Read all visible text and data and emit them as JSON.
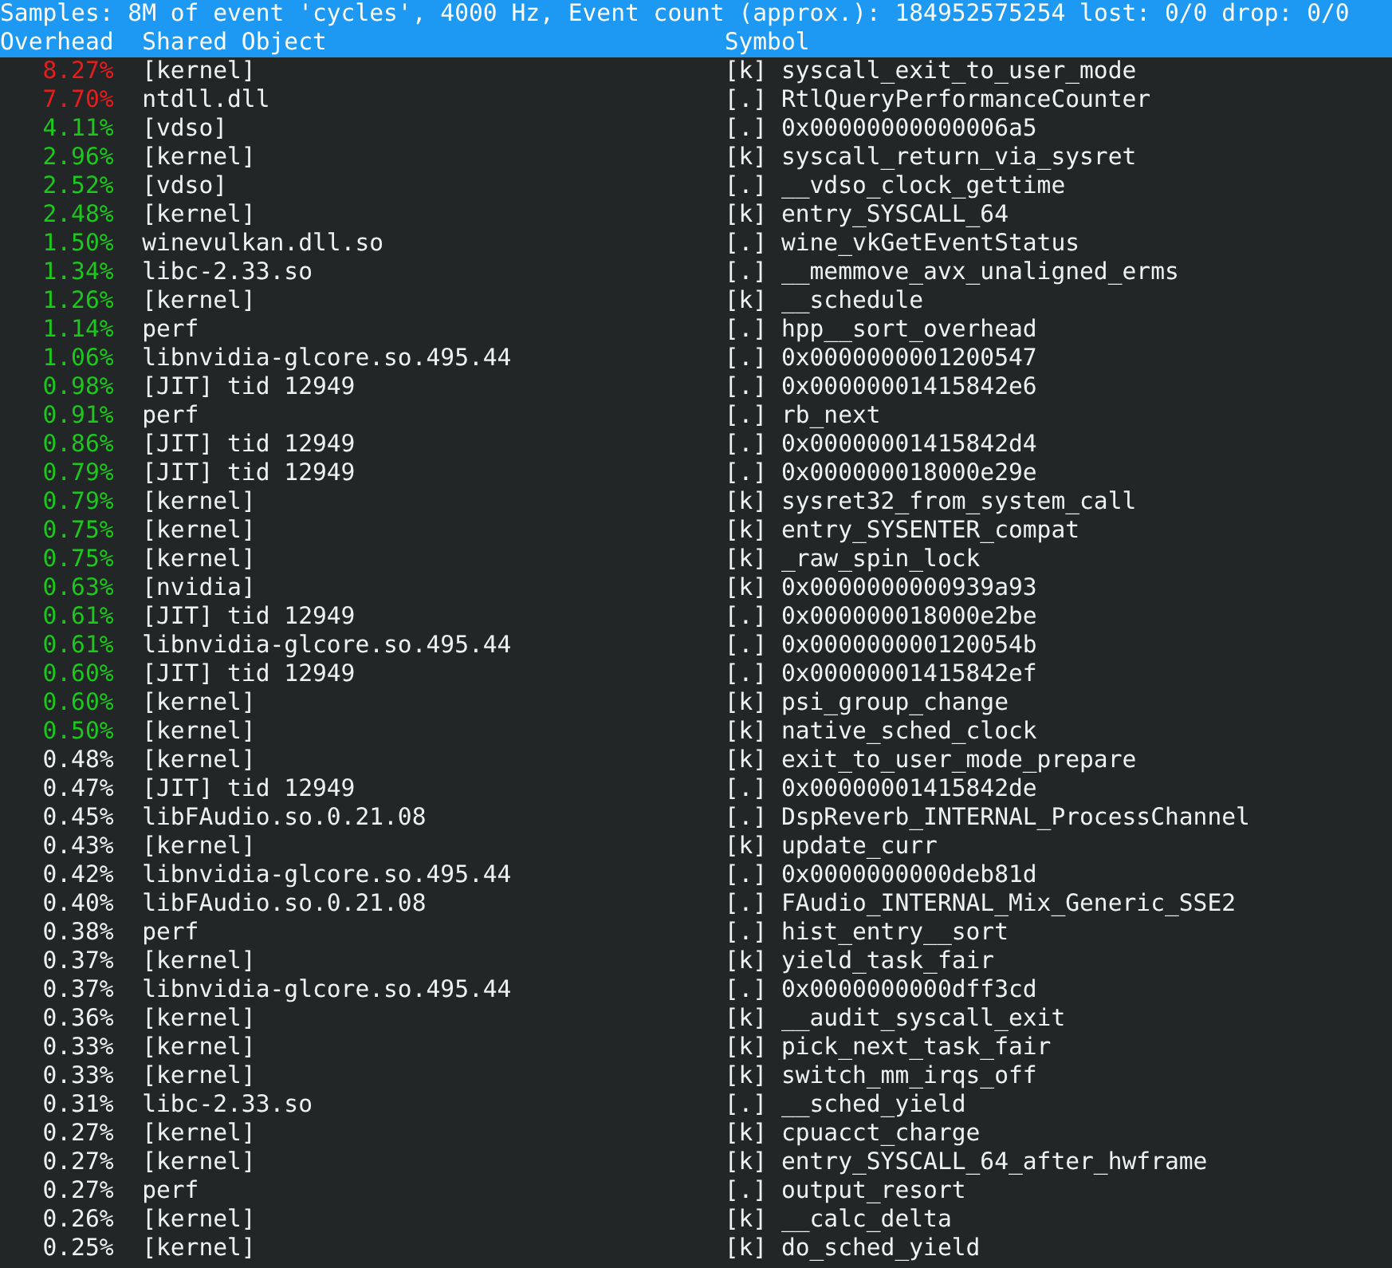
{
  "summary": "Samples: 8M of event 'cycles', 4000 Hz, Event count (approx.): 184952575254 lost: 0/0 drop: 0/0",
  "columns": [
    "Overhead",
    "Shared Object",
    "Symbol"
  ],
  "rows": [
    {
      "overhead": "8.27%",
      "color": "#e81c1c",
      "object": "[kernel]",
      "symbol": "[k] syscall_exit_to_user_mode"
    },
    {
      "overhead": "7.70%",
      "color": "#e81c1c",
      "object": "ntdll.dll",
      "symbol": "[.] RtlQueryPerformanceCounter"
    },
    {
      "overhead": "4.11%",
      "color": "#1cc81c",
      "object": "[vdso]",
      "symbol": "[.] 0x00000000000006a5"
    },
    {
      "overhead": "2.96%",
      "color": "#1cc81c",
      "object": "[kernel]",
      "symbol": "[k] syscall_return_via_sysret"
    },
    {
      "overhead": "2.52%",
      "color": "#1cc81c",
      "object": "[vdso]",
      "symbol": "[.] __vdso_clock_gettime"
    },
    {
      "overhead": "2.48%",
      "color": "#1cc81c",
      "object": "[kernel]",
      "symbol": "[k] entry_SYSCALL_64"
    },
    {
      "overhead": "1.50%",
      "color": "#1cc81c",
      "object": "winevulkan.dll.so",
      "symbol": "[.] wine_vkGetEventStatus"
    },
    {
      "overhead": "1.34%",
      "color": "#1cc81c",
      "object": "libc-2.33.so",
      "symbol": "[.] __memmove_avx_unaligned_erms"
    },
    {
      "overhead": "1.26%",
      "color": "#1cc81c",
      "object": "[kernel]",
      "symbol": "[k] __schedule"
    },
    {
      "overhead": "1.14%",
      "color": "#1cc81c",
      "object": "perf",
      "symbol": "[.] hpp__sort_overhead"
    },
    {
      "overhead": "1.06%",
      "color": "#1cc81c",
      "object": "libnvidia-glcore.so.495.44",
      "symbol": "[.] 0x0000000001200547"
    },
    {
      "overhead": "0.98%",
      "color": "#1cc81c",
      "object": "[JIT] tid 12949",
      "symbol": "[.] 0x00000001415842e6"
    },
    {
      "overhead": "0.91%",
      "color": "#1cc81c",
      "object": "perf",
      "symbol": "[.] rb_next"
    },
    {
      "overhead": "0.86%",
      "color": "#1cc81c",
      "object": "[JIT] tid 12949",
      "symbol": "[.] 0x00000001415842d4"
    },
    {
      "overhead": "0.79%",
      "color": "#1cc81c",
      "object": "[JIT] tid 12949",
      "symbol": "[.] 0x000000018000e29e"
    },
    {
      "overhead": "0.79%",
      "color": "#1cc81c",
      "object": "[kernel]",
      "symbol": "[k] sysret32_from_system_call"
    },
    {
      "overhead": "0.75%",
      "color": "#1cc81c",
      "object": "[kernel]",
      "symbol": "[k] entry_SYSENTER_compat"
    },
    {
      "overhead": "0.75%",
      "color": "#1cc81c",
      "object": "[kernel]",
      "symbol": "[k] _raw_spin_lock"
    },
    {
      "overhead": "0.63%",
      "color": "#1cc81c",
      "object": "[nvidia]",
      "symbol": "[k] 0x0000000000939a93"
    },
    {
      "overhead": "0.61%",
      "color": "#1cc81c",
      "object": "[JIT] tid 12949",
      "symbol": "[.] 0x000000018000e2be"
    },
    {
      "overhead": "0.61%",
      "color": "#1cc81c",
      "object": "libnvidia-glcore.so.495.44",
      "symbol": "[.] 0x000000000120054b"
    },
    {
      "overhead": "0.60%",
      "color": "#1cc81c",
      "object": "[JIT] tid 12949",
      "symbol": "[.] 0x00000001415842ef"
    },
    {
      "overhead": "0.60%",
      "color": "#1cc81c",
      "object": "[kernel]",
      "symbol": "[k] psi_group_change"
    },
    {
      "overhead": "0.50%",
      "color": "#1cc81c",
      "object": "[kernel]",
      "symbol": "[k] native_sched_clock"
    },
    {
      "overhead": "0.48%",
      "color": "#eff0f1",
      "object": "[kernel]",
      "symbol": "[k] exit_to_user_mode_prepare"
    },
    {
      "overhead": "0.47%",
      "color": "#eff0f1",
      "object": "[JIT] tid 12949",
      "symbol": "[.] 0x00000001415842de"
    },
    {
      "overhead": "0.45%",
      "color": "#eff0f1",
      "object": "libFAudio.so.0.21.08",
      "symbol": "[.] DspReverb_INTERNAL_ProcessChannel"
    },
    {
      "overhead": "0.43%",
      "color": "#eff0f1",
      "object": "[kernel]",
      "symbol": "[k] update_curr"
    },
    {
      "overhead": "0.42%",
      "color": "#eff0f1",
      "object": "libnvidia-glcore.so.495.44",
      "symbol": "[.] 0x0000000000deb81d"
    },
    {
      "overhead": "0.40%",
      "color": "#eff0f1",
      "object": "libFAudio.so.0.21.08",
      "symbol": "[.] FAudio_INTERNAL_Mix_Generic_SSE2"
    },
    {
      "overhead": "0.38%",
      "color": "#eff0f1",
      "object": "perf",
      "symbol": "[.] hist_entry__sort"
    },
    {
      "overhead": "0.37%",
      "color": "#eff0f1",
      "object": "[kernel]",
      "symbol": "[k] yield_task_fair"
    },
    {
      "overhead": "0.37%",
      "color": "#eff0f1",
      "object": "libnvidia-glcore.so.495.44",
      "symbol": "[.] 0x0000000000dff3cd"
    },
    {
      "overhead": "0.36%",
      "color": "#eff0f1",
      "object": "[kernel]",
      "symbol": "[k] __audit_syscall_exit"
    },
    {
      "overhead": "0.33%",
      "color": "#eff0f1",
      "object": "[kernel]",
      "symbol": "[k] pick_next_task_fair"
    },
    {
      "overhead": "0.33%",
      "color": "#eff0f1",
      "object": "[kernel]",
      "symbol": "[k] switch_mm_irqs_off"
    },
    {
      "overhead": "0.31%",
      "color": "#eff0f1",
      "object": "libc-2.33.so",
      "symbol": "[.] __sched_yield"
    },
    {
      "overhead": "0.27%",
      "color": "#eff0f1",
      "object": "[kernel]",
      "symbol": "[k] cpuacct_charge"
    },
    {
      "overhead": "0.27%",
      "color": "#eff0f1",
      "object": "[kernel]",
      "symbol": "[k] entry_SYSCALL_64_after_hwframe"
    },
    {
      "overhead": "0.27%",
      "color": "#eff0f1",
      "object": "perf",
      "symbol": "[.] output_resort"
    },
    {
      "overhead": "0.26%",
      "color": "#eff0f1",
      "object": "[kernel]",
      "symbol": "[k] __calc_delta"
    },
    {
      "overhead": "0.25%",
      "color": "#eff0f1",
      "object": "[kernel]",
      "symbol": "[k] do_sched_yield"
    }
  ]
}
